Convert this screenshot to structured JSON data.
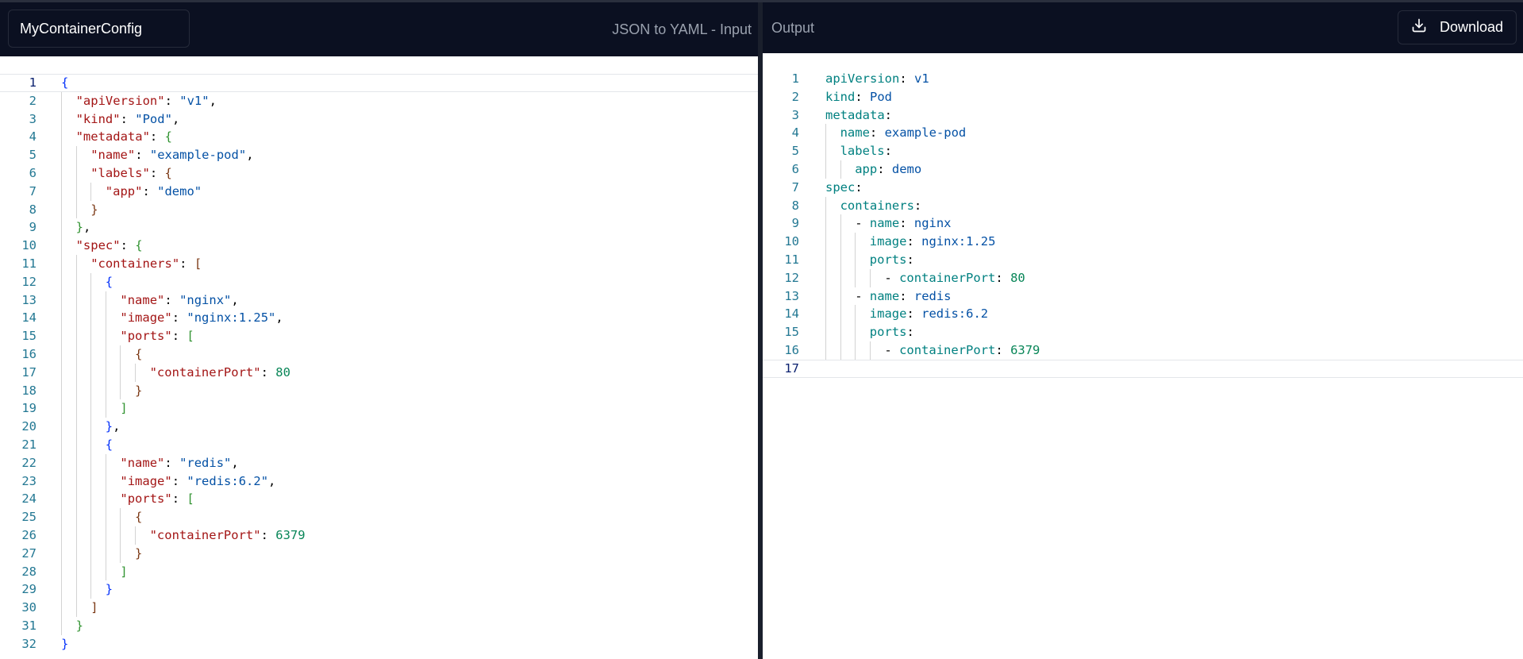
{
  "input_panel": {
    "config_name": "MyContainerConfig",
    "title": "JSON to YAML - Input",
    "lines": [
      [
        [
          "b1",
          "{"
        ]
      ],
      [
        [
          "t-key",
          "\"apiVersion\""
        ],
        [
          "t-punc",
          ": "
        ],
        [
          "t-str",
          "\"v1\""
        ],
        [
          "t-punc",
          ","
        ]
      ],
      [
        [
          "t-key",
          "\"kind\""
        ],
        [
          "t-punc",
          ": "
        ],
        [
          "t-str",
          "\"Pod\""
        ],
        [
          "t-punc",
          ","
        ]
      ],
      [
        [
          "t-key",
          "\"metadata\""
        ],
        [
          "t-punc",
          ": "
        ],
        [
          "b2",
          "{"
        ]
      ],
      [
        [
          "t-key",
          "\"name\""
        ],
        [
          "t-punc",
          ": "
        ],
        [
          "t-str",
          "\"example-pod\""
        ],
        [
          "t-punc",
          ","
        ]
      ],
      [
        [
          "t-key",
          "\"labels\""
        ],
        [
          "t-punc",
          ": "
        ],
        [
          "b3",
          "{"
        ]
      ],
      [
        [
          "t-key",
          "\"app\""
        ],
        [
          "t-punc",
          ": "
        ],
        [
          "t-str",
          "\"demo\""
        ]
      ],
      [
        [
          "b3",
          "}"
        ]
      ],
      [
        [
          "b2",
          "}"
        ],
        [
          "t-punc",
          ","
        ]
      ],
      [
        [
          "t-key",
          "\"spec\""
        ],
        [
          "t-punc",
          ": "
        ],
        [
          "b2",
          "{"
        ]
      ],
      [
        [
          "t-key",
          "\"containers\""
        ],
        [
          "t-punc",
          ": "
        ],
        [
          "b3",
          "["
        ]
      ],
      [
        [
          "b1",
          "{"
        ]
      ],
      [
        [
          "t-key",
          "\"name\""
        ],
        [
          "t-punc",
          ": "
        ],
        [
          "t-str",
          "\"nginx\""
        ],
        [
          "t-punc",
          ","
        ]
      ],
      [
        [
          "t-key",
          "\"image\""
        ],
        [
          "t-punc",
          ": "
        ],
        [
          "t-str",
          "\"nginx:1.25\""
        ],
        [
          "t-punc",
          ","
        ]
      ],
      [
        [
          "t-key",
          "\"ports\""
        ],
        [
          "t-punc",
          ": "
        ],
        [
          "b2",
          "["
        ]
      ],
      [
        [
          "b3",
          "{"
        ]
      ],
      [
        [
          "t-key",
          "\"containerPort\""
        ],
        [
          "t-punc",
          ": "
        ],
        [
          "t-num",
          "80"
        ]
      ],
      [
        [
          "b3",
          "}"
        ]
      ],
      [
        [
          "b2",
          "]"
        ]
      ],
      [
        [
          "b1",
          "}"
        ],
        [
          "t-punc",
          ","
        ]
      ],
      [
        [
          "b1",
          "{"
        ]
      ],
      [
        [
          "t-key",
          "\"name\""
        ],
        [
          "t-punc",
          ": "
        ],
        [
          "t-str",
          "\"redis\""
        ],
        [
          "t-punc",
          ","
        ]
      ],
      [
        [
          "t-key",
          "\"image\""
        ],
        [
          "t-punc",
          ": "
        ],
        [
          "t-str",
          "\"redis:6.2\""
        ],
        [
          "t-punc",
          ","
        ]
      ],
      [
        [
          "t-key",
          "\"ports\""
        ],
        [
          "t-punc",
          ": "
        ],
        [
          "b2",
          "["
        ]
      ],
      [
        [
          "b3",
          "{"
        ]
      ],
      [
        [
          "t-key",
          "\"containerPort\""
        ],
        [
          "t-punc",
          ": "
        ],
        [
          "t-num",
          "6379"
        ]
      ],
      [
        [
          "b3",
          "}"
        ]
      ],
      [
        [
          "b2",
          "]"
        ]
      ],
      [
        [
          "b1",
          "}"
        ]
      ],
      [
        [
          "b3",
          "]"
        ]
      ],
      [
        [
          "b2",
          "}"
        ]
      ],
      [
        [
          "b1",
          "}"
        ]
      ]
    ],
    "indents": [
      0,
      1,
      1,
      1,
      2,
      2,
      3,
      2,
      1,
      1,
      2,
      3,
      4,
      4,
      4,
      5,
      6,
      5,
      4,
      3,
      3,
      4,
      4,
      4,
      5,
      6,
      5,
      4,
      3,
      2,
      1,
      0
    ],
    "active_line": 1
  },
  "output_panel": {
    "title": "Output",
    "download_label": "Download",
    "lines": [
      [
        [
          "y-key",
          "apiVersion"
        ],
        [
          "t-punc",
          ": "
        ],
        [
          "y-val",
          "v1"
        ]
      ],
      [
        [
          "y-key",
          "kind"
        ],
        [
          "t-punc",
          ": "
        ],
        [
          "y-val",
          "Pod"
        ]
      ],
      [
        [
          "y-key",
          "metadata"
        ],
        [
          "t-punc",
          ":"
        ]
      ],
      [
        [
          "y-key",
          "name"
        ],
        [
          "t-punc",
          ": "
        ],
        [
          "y-val",
          "example-pod"
        ]
      ],
      [
        [
          "y-key",
          "labels"
        ],
        [
          "t-punc",
          ":"
        ]
      ],
      [
        [
          "y-key",
          "app"
        ],
        [
          "t-punc",
          ": "
        ],
        [
          "y-val",
          "demo"
        ]
      ],
      [
        [
          "y-key",
          "spec"
        ],
        [
          "t-punc",
          ":"
        ]
      ],
      [
        [
          "y-key",
          "containers"
        ],
        [
          "t-punc",
          ":"
        ]
      ],
      [
        [
          "t-punc",
          "- "
        ],
        [
          "y-key",
          "name"
        ],
        [
          "t-punc",
          ": "
        ],
        [
          "y-val",
          "nginx"
        ]
      ],
      [
        [
          "y-key",
          "image"
        ],
        [
          "t-punc",
          ": "
        ],
        [
          "y-val",
          "nginx:1.25"
        ]
      ],
      [
        [
          "y-key",
          "ports"
        ],
        [
          "t-punc",
          ":"
        ]
      ],
      [
        [
          "t-punc",
          "- "
        ],
        [
          "y-key",
          "containerPort"
        ],
        [
          "t-punc",
          ": "
        ],
        [
          "y-num",
          "80"
        ]
      ],
      [
        [
          "t-punc",
          "- "
        ],
        [
          "y-key",
          "name"
        ],
        [
          "t-punc",
          ": "
        ],
        [
          "y-val",
          "redis"
        ]
      ],
      [
        [
          "y-key",
          "image"
        ],
        [
          "t-punc",
          ": "
        ],
        [
          "y-val",
          "redis:6.2"
        ]
      ],
      [
        [
          "y-key",
          "ports"
        ],
        [
          "t-punc",
          ":"
        ]
      ],
      [
        [
          "t-punc",
          "- "
        ],
        [
          "y-key",
          "containerPort"
        ],
        [
          "t-punc",
          ": "
        ],
        [
          "y-num",
          "6379"
        ]
      ],
      []
    ],
    "indents": [
      0,
      0,
      0,
      1,
      1,
      2,
      0,
      1,
      2,
      3,
      3,
      4,
      2,
      3,
      3,
      4,
      0
    ],
    "active_line": 17
  },
  "icons": {
    "download": "download-icon"
  }
}
